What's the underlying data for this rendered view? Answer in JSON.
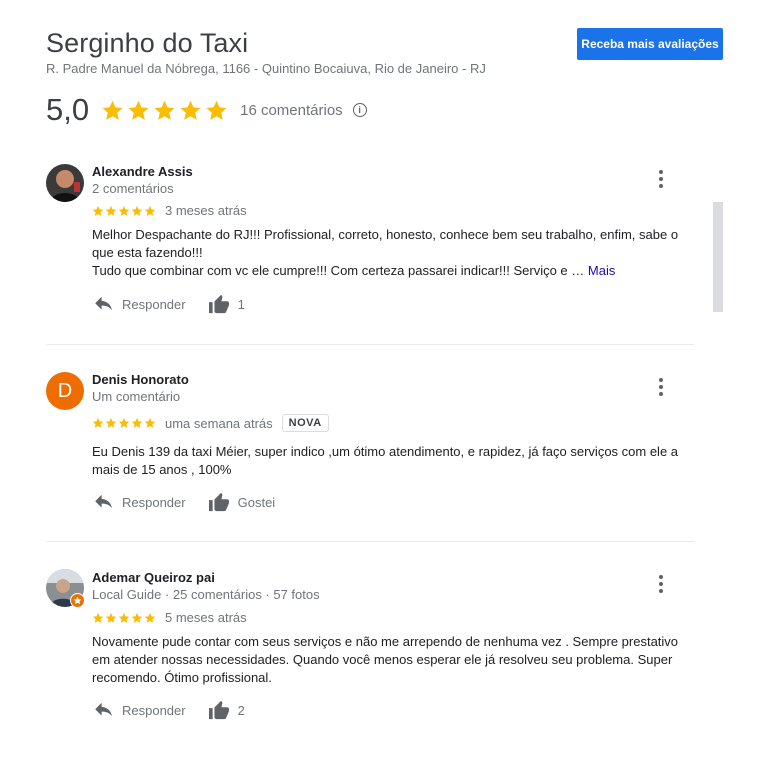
{
  "business": {
    "name": "Serginho do Taxi",
    "address": "R. Padre Manuel da Nóbrega, 1166 - Quintino Bocaiuva, Rio de Janeiro - RJ",
    "cta_label": "Receba mais avaliações",
    "rating": "5,0",
    "stars": 5,
    "review_count": "16 comentários"
  },
  "icons": {
    "info": "i"
  },
  "colors": {
    "star": "#fbbc04",
    "cta": "#1a73e8",
    "link": "#1a0dab"
  },
  "reviews": [
    {
      "author": "Alexandre Assis",
      "meta": "2 comentários",
      "stars": 5,
      "date": "3 meses atrás",
      "text_line1": "Melhor Despachante do RJ!!! Profissional, correto, honesto, conhece bem seu trabalho, enfim, sabe o",
      "text_line2": "que esta fazendo!!!",
      "text_line3": "Tudo que combinar com vc ele cumpre!!! Com certeza passarei indicar!!! Serviço e …",
      "more_label": "Mais",
      "reply_label": "Responder",
      "like_label": "1"
    },
    {
      "author": "Denis Honorato",
      "avatar_letter": "D",
      "meta": "Um comentário",
      "stars": 5,
      "date": "uma semana atrás",
      "badge": "NOVA",
      "text_line1": "Eu Denis 139 da taxi Méier, super indico ,um ótimo atendimento, e rapidez, já faço serviços com ele a",
      "text_line2": "mais de 15 anos , 100%",
      "reply_label": "Responder",
      "like_label": "Gostei"
    },
    {
      "author": "Ademar Queiroz pai",
      "meta": "Local Guide · 25 comentários · 57 fotos",
      "stars": 5,
      "date": "5 meses atrás",
      "text_line1": "Novamente pude contar com seus serviços e não me arrependo de nenhuma vez . Sempre prestativo",
      "text_line2": "em atender nossas necessidades.  Quando você menos esperar ele já resolveu seu problema. Super",
      "text_line3": "recomendo.  Ótimo profissional.",
      "reply_label": "Responder",
      "like_label": "2"
    }
  ]
}
